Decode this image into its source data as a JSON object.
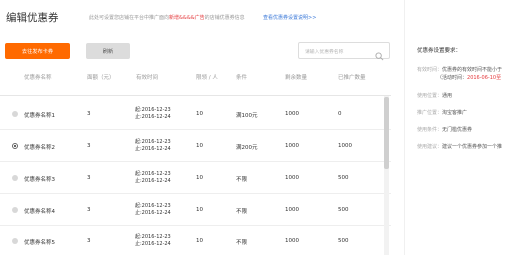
{
  "header": {
    "title": "编辑优惠券",
    "tip_prefix": "此处可设置您店铺在平台中推广面向",
    "tip_highlight": "新增&&&&广告",
    "tip_suffix": "的店铺优惠券信息",
    "tip_link": "查看优惠券设置说明>>"
  },
  "toolbar": {
    "add_label": "去往发布卡券",
    "refresh_label": "刷新",
    "search_placeholder": "请输入优惠券名称"
  },
  "table": {
    "columns": [
      "优惠券名称",
      "面额（元）",
      "有效时间",
      "限领 / 人",
      "条件",
      "剩余数量",
      "已推广数量"
    ],
    "rows": [
      {
        "name": "优惠券名称1",
        "amount": "3",
        "start": "起:2016-12-23",
        "end": "止:2016-12-24",
        "limit": "10",
        "condition": "满100元",
        "remain": "1000",
        "promoted": "0",
        "selected": false
      },
      {
        "name": "优惠券名称2",
        "amount": "3",
        "start": "起:2016-12-23",
        "end": "止:2016-12-24",
        "limit": "10",
        "condition": "满200元",
        "remain": "1000",
        "promoted": "1000",
        "selected": true
      },
      {
        "name": "优惠券名称3",
        "amount": "3",
        "start": "起:2016-12-23",
        "end": "止:2016-12-24",
        "limit": "10",
        "condition": "不限",
        "remain": "1000",
        "promoted": "500",
        "selected": false
      },
      {
        "name": "优惠券名称4",
        "amount": "3",
        "start": "起:2016-12-23",
        "end": "止:2016-12-24",
        "limit": "10",
        "condition": "不限",
        "remain": "1000",
        "promoted": "500",
        "selected": false
      },
      {
        "name": "优惠券名称5",
        "amount": "3",
        "start": "起:2016-12-23",
        "end": "止:2016-12-24",
        "limit": "10",
        "condition": "不限",
        "remain": "1000",
        "promoted": "500",
        "selected": false
      }
    ]
  },
  "requirements": {
    "heading": "优惠券设置要求：",
    "validity_label": "有效时间：",
    "validity_text": "优惠券的有效时间不能小于",
    "validity_sub_prefix": "（活动时间：",
    "validity_sub_date": "2016-06-10至",
    "scope_label": "使用位置：",
    "scope_value": "通用",
    "channel_label": "推广位置：",
    "channel_value": "淘宝客推广",
    "condition_label": "使用条件：",
    "condition_value": "无门槛优惠券",
    "advice_label": "使用建议：",
    "advice_value": "建议一个优惠券参加一个推"
  },
  "colors": {
    "primary": "#ff6a00",
    "link": "#3a78d8",
    "highlight": "#e4393c"
  }
}
